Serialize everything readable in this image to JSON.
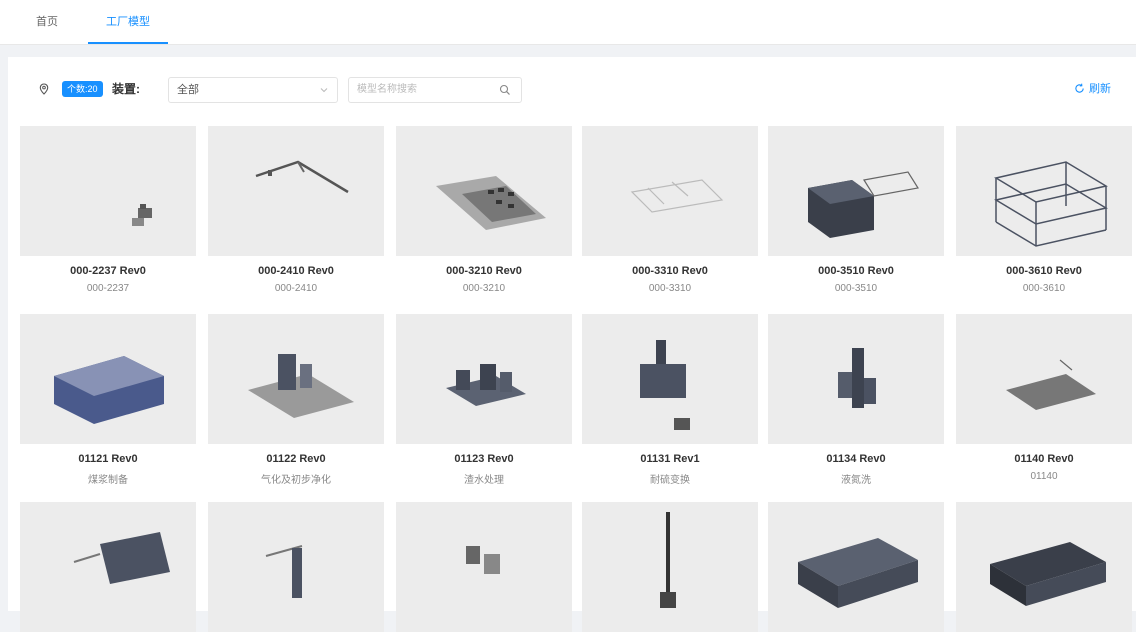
{
  "tabs": [
    {
      "label": "首页"
    },
    {
      "label": "工厂模型"
    }
  ],
  "toolbar": {
    "badge": "个数:20",
    "device_label": "装置:",
    "device_value": "全部",
    "search_placeholder": "模型名称搜索",
    "refresh_label": "刷新"
  },
  "colors": {
    "accent": "#1890ff"
  },
  "models": [
    {
      "title": "000-2237 Rev0",
      "sub": "000-2237"
    },
    {
      "title": "000-2410 Rev0",
      "sub": "000-2410"
    },
    {
      "title": "000-3210 Rev0",
      "sub": "000-3210"
    },
    {
      "title": "000-3310 Rev0",
      "sub": "000-3310"
    },
    {
      "title": "000-3510 Rev0",
      "sub": "000-3510"
    },
    {
      "title": "000-3610 Rev0",
      "sub": "000-3610"
    },
    {
      "title": "01121 Rev0",
      "sub": "煤浆制备"
    },
    {
      "title": "01122 Rev0",
      "sub": "气化及初步净化"
    },
    {
      "title": "01123 Rev0",
      "sub": "渣水处理"
    },
    {
      "title": "01131 Rev1",
      "sub": "耐硫变换"
    },
    {
      "title": "01134 Rev0",
      "sub": "液氮洗"
    },
    {
      "title": "01140 Rev0",
      "sub": "01140"
    },
    {
      "title": "",
      "sub": ""
    },
    {
      "title": "",
      "sub": ""
    },
    {
      "title": "",
      "sub": ""
    },
    {
      "title": "",
      "sub": ""
    },
    {
      "title": "",
      "sub": ""
    },
    {
      "title": "",
      "sub": ""
    }
  ]
}
